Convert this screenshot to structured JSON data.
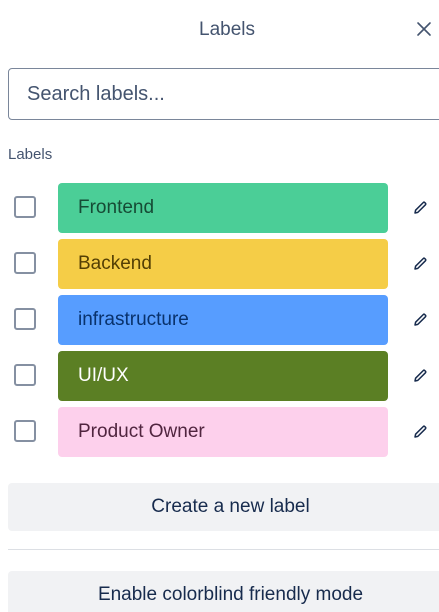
{
  "header": {
    "title": "Labels",
    "close_icon": "close-icon"
  },
  "search": {
    "placeholder": "Search labels...",
    "value": ""
  },
  "section_title": "Labels",
  "labels": [
    {
      "name": "Frontend",
      "color": "#4bce97",
      "text_color": "#164b35",
      "checked": false
    },
    {
      "name": "Backend",
      "color": "#f5cd47",
      "text_color": "#533f04",
      "checked": false
    },
    {
      "name": "infrastructure",
      "color": "#579dff",
      "text_color": "#09326c",
      "checked": false
    },
    {
      "name": "UI/UX",
      "color": "#5b7f24",
      "text_color": "#ffffff",
      "checked": false
    },
    {
      "name": "Product Owner",
      "color": "#fdd0ec",
      "text_color": "#50253f",
      "checked": false
    }
  ],
  "buttons": {
    "create_label": "Create a new label",
    "colorblind": "Enable colorblind friendly mode"
  },
  "icons": {
    "edit": "pencil-icon",
    "close": "close-icon"
  }
}
